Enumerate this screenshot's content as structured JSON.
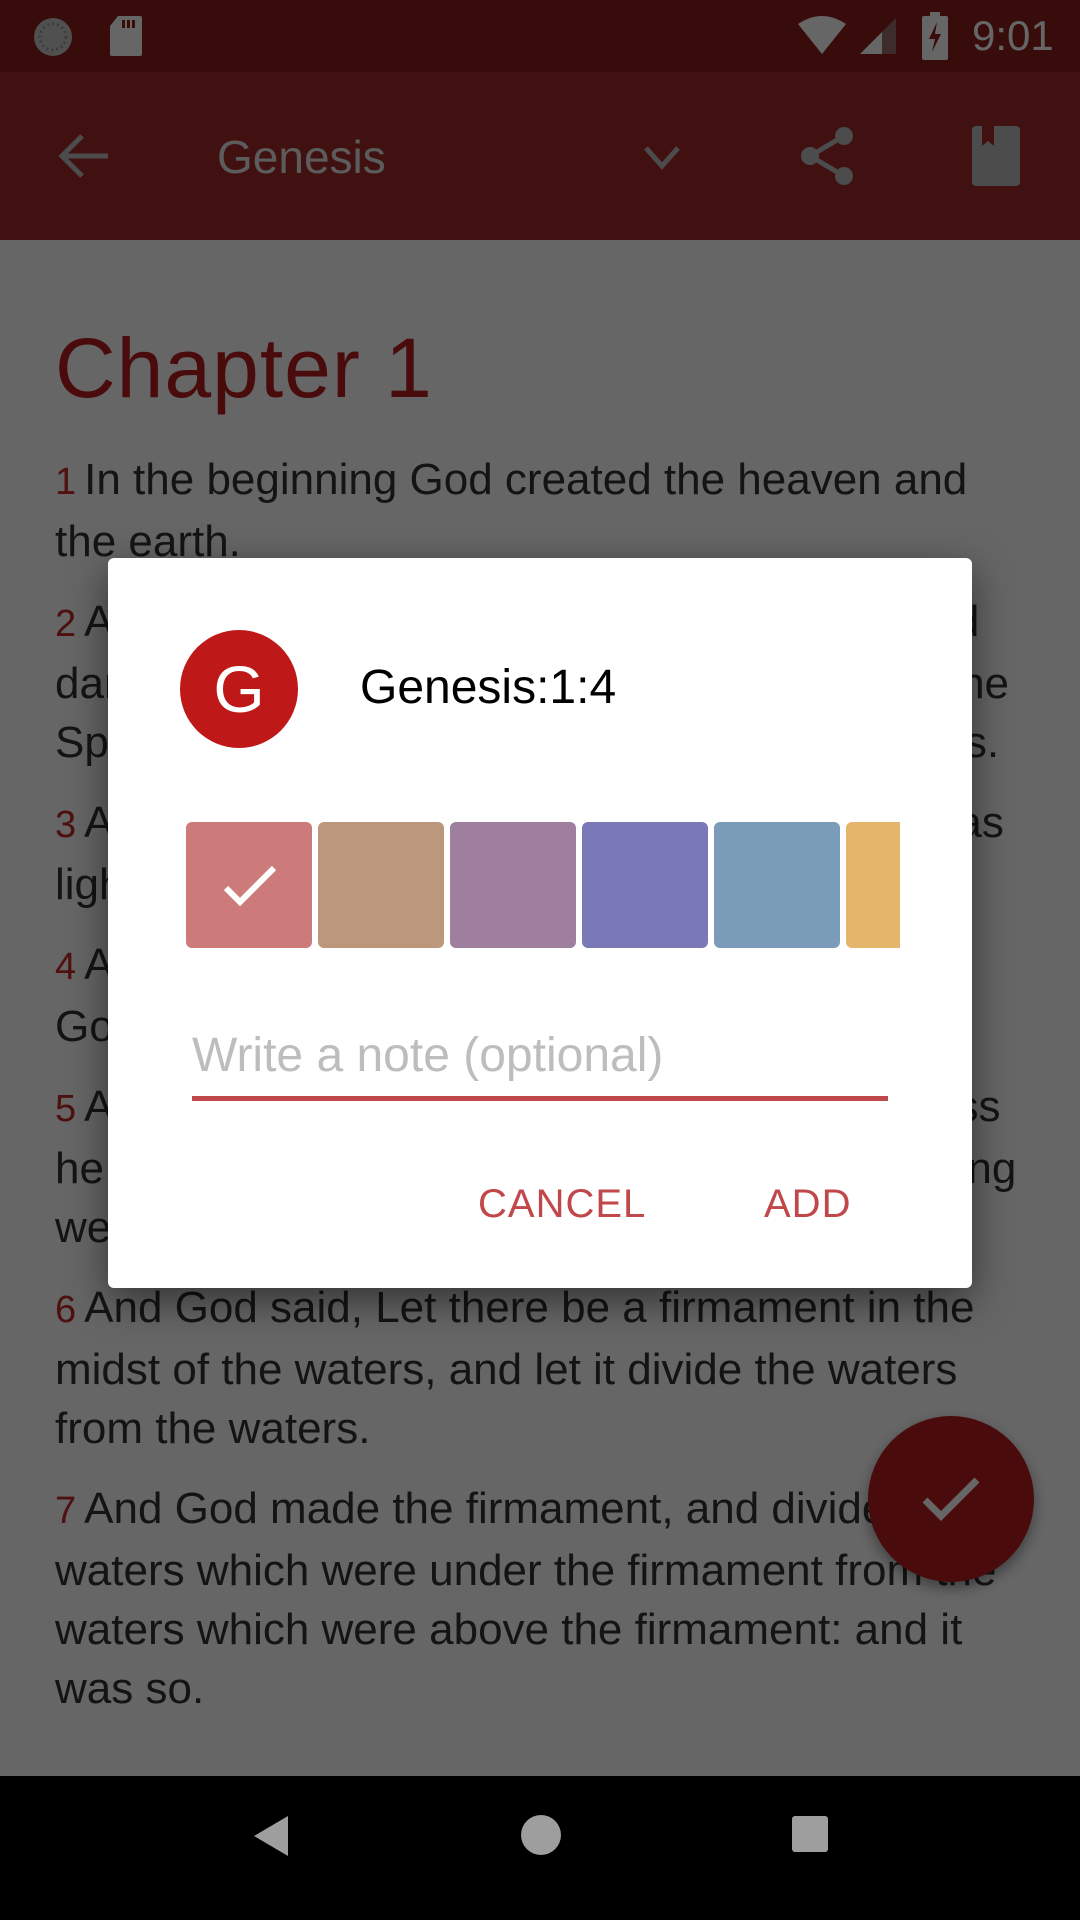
{
  "status_bar": {
    "time": "9:01",
    "icons": [
      "sync-icon",
      "sd-card-icon",
      "wifi-icon",
      "cell-signal-icon",
      "battery-charging-icon"
    ]
  },
  "app_bar": {
    "title": "Genesis",
    "icons": [
      "back-arrow-icon",
      "chevron-down-icon",
      "share-icon",
      "bookmark-icon"
    ]
  },
  "content": {
    "chapter_title": "Chapter 1",
    "verses": [
      {
        "num": "1",
        "text": "In the beginning God created the heaven and the earth."
      },
      {
        "num": "2",
        "text": "And the earth was without form, and void; and darkness was upon the face of the deep. And the Spirit of God moved upon the face of the waters."
      },
      {
        "num": "3",
        "text": "And God said, Let there be light: and there was light."
      },
      {
        "num": "4",
        "text": "And God saw the light, that it was good: and God divided the light from the darkness."
      },
      {
        "num": "5",
        "text": "And God called the light Day, and the darkness he called Night. And the evening and the morning were the first day."
      },
      {
        "num": "6",
        "text": "And God said, Let there be a firmament in the midst of the waters, and let it divide the waters from the waters."
      },
      {
        "num": "7",
        "text": "And God made the firmament, and divided the waters which were under the firmament from the waters which were above the firmament: and it was so."
      }
    ]
  },
  "fab": {
    "icon": "check-icon"
  },
  "dialog": {
    "avatar_letter": "G",
    "title": "Genesis:1:4",
    "colors": [
      {
        "hex": "#cc7a7a",
        "selected": true
      },
      {
        "hex": "#bd977c",
        "selected": false
      },
      {
        "hex": "#9e7f9e",
        "selected": false
      },
      {
        "hex": "#7b78b8",
        "selected": false
      },
      {
        "hex": "#7b9cb8",
        "selected": false
      },
      {
        "hex": "#e5b56b",
        "selected": false
      }
    ],
    "note_placeholder": "Write a note (optional)",
    "note_value": "",
    "cancel_label": "CANCEL",
    "add_label": "ADD"
  },
  "theme": {
    "primary": "#a32c2c",
    "primary_dark": "#8e1e1e",
    "accent": "#c0474a",
    "avatar": "#bf1818"
  }
}
